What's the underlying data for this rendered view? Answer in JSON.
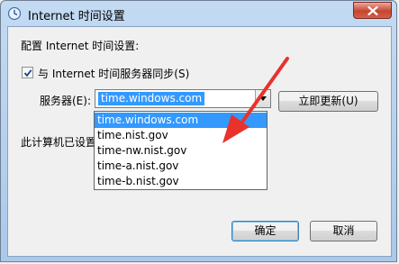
{
  "window": {
    "title": "Internet 时间设置",
    "icon": "clock-globe-icon",
    "close_icon": "close-icon"
  },
  "dialog": {
    "heading": "配置 Internet 时间设置:",
    "sync_checkbox": {
      "label": "与 Internet 时间服务器同步(S)",
      "checked": true
    },
    "server_label": "服务器(E):",
    "server_value": "time.windows.com",
    "update_button": "立即更新(U)",
    "status_text": "此计算机已设置"
  },
  "dropdown": {
    "options": [
      "time.windows.com",
      "time.nist.gov",
      "time-nw.nist.gov",
      "time-a.nist.gov",
      "time-b.nist.gov"
    ],
    "selected_index": 0
  },
  "buttons": {
    "ok": "确定",
    "cancel": "取消"
  },
  "colors": {
    "selection": "#3399ff",
    "annotation_arrow": "#e8322b"
  }
}
